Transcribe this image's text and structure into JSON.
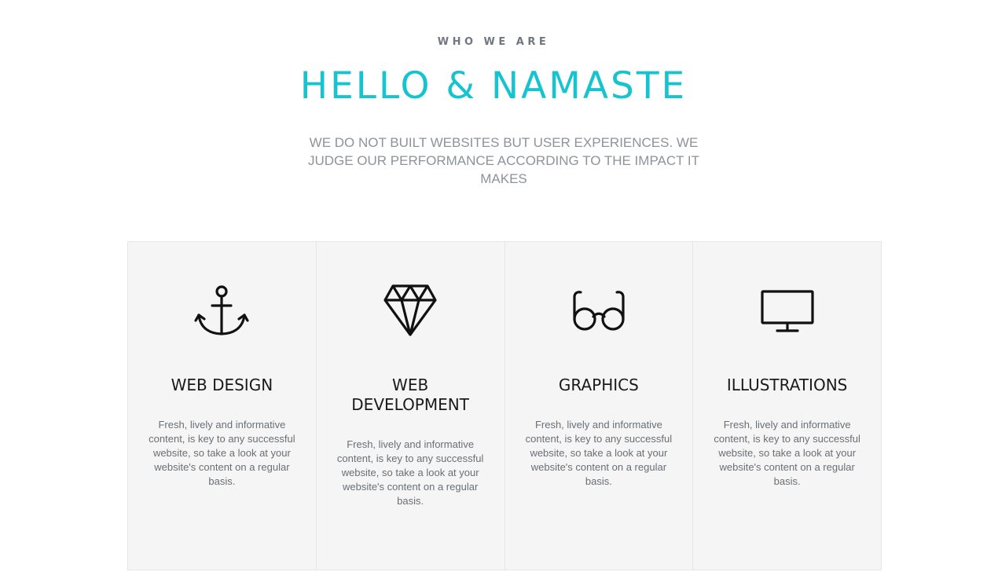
{
  "header": {
    "eyebrow": "WHO WE ARE",
    "headline": "HELLO & NAMASTE",
    "intro": "WE DO NOT BUILT WEBSITES BUT USER EXPERIENCES. WE JUDGE OUR PERFORMANCE ACCORDING TO THE IMPACT IT MAKES"
  },
  "colors": {
    "accent": "#17c3cf",
    "card_background": "#f5f5f5",
    "text_dark": "#1a1a1a",
    "text_muted": "#8d9399"
  },
  "services": [
    {
      "icon": "anchor-icon",
      "title": "WEB DESIGN",
      "description": "Fresh, lively and informative content, is key to any successful website, so take a look at your website's content on a regular basis."
    },
    {
      "icon": "diamond-icon",
      "title": "WEB DEVELOPMENT",
      "description": "Fresh, lively and informative content, is key to any successful website, so take a look at your website's content on a regular basis."
    },
    {
      "icon": "glasses-icon",
      "title": "GRAPHICS",
      "description": "Fresh, lively and informative content, is key to any successful website, so take a look at your website's content on a regular basis."
    },
    {
      "icon": "monitor-icon",
      "title": "ILLUSTRATIONS",
      "description": "Fresh, lively and informative content, is key to any successful website, so take a look at your website's content on a regular basis."
    }
  ]
}
